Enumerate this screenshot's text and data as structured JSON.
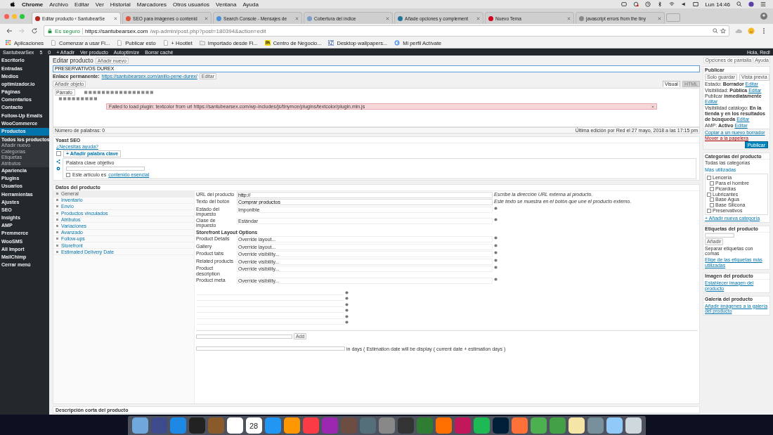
{
  "menubar": {
    "app": "Chrome",
    "items": [
      "Archivo",
      "Editar",
      "Ver",
      "Historial",
      "Marcadores",
      "Otros usuarios",
      "Ventana",
      "Ayuda"
    ],
    "clock": "Lun 14:46"
  },
  "tabs": [
    {
      "title": "Editar producto ‹ SantubearSe",
      "selected": true,
      "color": "#b3261e"
    },
    {
      "title": "SEO para imágenes o contenid",
      "selected": false,
      "color": "#e0533d"
    },
    {
      "title": "Search Console - Mensajes de",
      "selected": false,
      "color": "#4a90d9"
    },
    {
      "title": "Cobertura del índice",
      "selected": false,
      "color": "#7a9cc6"
    },
    {
      "title": "Añade opciones y complement",
      "selected": false,
      "color": "#21759b"
    },
    {
      "title": "Nuevo Tema",
      "selected": false,
      "color": "#d0021b"
    },
    {
      "title": "javascript errors from the tiny",
      "selected": false,
      "color": "#888888"
    }
  ],
  "address": {
    "secure_label": "Es seguro",
    "url_host": "https://santubearsex.com",
    "url_path": "/wp-admin/post.php?post=180394&action=edit"
  },
  "bookmarks": [
    {
      "label": "Aplicaciones",
      "kind": "apps"
    },
    {
      "label": "Comenzar a usar Fi...",
      "kind": "page"
    },
    {
      "label": "Publicar esto",
      "kind": "page"
    },
    {
      "label": "+ Hootlet",
      "kind": "page"
    },
    {
      "label": "Importado desde Fi...",
      "kind": "folder"
    },
    {
      "label": "Centro de Negocio...",
      "kind": "pa"
    },
    {
      "label": "Desktop wallpapers...",
      "kind": "iz"
    },
    {
      "label": "Mi perfil Actívate",
      "kind": "g"
    }
  ],
  "admin_bar": {
    "items": [
      "SantubearSex",
      "5",
      "0",
      "+ Añadir",
      "Ver producto",
      "Autoptimize",
      "Borrar caché"
    ],
    "greeting": "Hola, Red!"
  },
  "sidebar": {
    "items": [
      {
        "label": "Escritorio",
        "selected": false
      },
      {
        "label": "Entradas",
        "selected": false
      },
      {
        "label": "Medios",
        "selected": false
      },
      {
        "label": "optimizador.io",
        "selected": false
      },
      {
        "label": "Páginas",
        "selected": false
      },
      {
        "label": "Comentarios",
        "selected": false
      },
      {
        "label": "Contacto",
        "selected": false
      },
      {
        "label": "Follow-Up Emails",
        "selected": false
      },
      {
        "label": "WooCommerce",
        "selected": false
      },
      {
        "label": "Productos",
        "selected": true,
        "children": [
          {
            "label": "Todos los productos",
            "selected": true
          },
          {
            "label": "Añadir nuevo",
            "selected": false
          },
          {
            "label": "Categorías",
            "selected": false
          },
          {
            "label": "Etiquetas",
            "selected": false
          },
          {
            "label": "Atributos",
            "selected": false
          }
        ]
      },
      {
        "label": "Apariencia",
        "selected": false
      },
      {
        "label": "Plugins",
        "selected": false
      },
      {
        "label": "Usuarios",
        "selected": false
      },
      {
        "label": "Herramientas",
        "selected": false
      },
      {
        "label": "Ajustes",
        "selected": false
      },
      {
        "label": "SEO",
        "selected": false
      },
      {
        "label": "Insights",
        "selected": false
      },
      {
        "label": "AMP",
        "selected": false
      },
      {
        "label": "Premmerce",
        "selected": false
      },
      {
        "label": "WooSMS",
        "selected": false
      },
      {
        "label": "All Import",
        "selected": false
      },
      {
        "label": "MailChimp",
        "selected": false
      },
      {
        "label": "Cerrar menú",
        "selected": false
      }
    ]
  },
  "screen_options": "Opciones de pantalla",
  "help": "Ayuda",
  "page": {
    "heading": "Editar producto",
    "add_new": "Añadir nuevo",
    "title_value": "PRESERVATIVOS DUREX",
    "permalink_label": "Enlace permanente:",
    "permalink_url": "https://santubearsex.com/anillo-pene-durex/",
    "permalink_edit": "Editar"
  },
  "editor": {
    "add_media": "Añadir objeto",
    "tabs": [
      {
        "label": "Visual",
        "selected": true
      },
      {
        "label": "HTML",
        "selected": false
      }
    ],
    "format": "Párrafo",
    "notice": "Failed to load plugin: textcolor from url https://santubearsex.com/wp-includes/js/tinymce/plugins/textcolor/plugin.min.js",
    "word_count": "Número de palabras: 0",
    "last_edit": "Última edición por Red el 27 mayo, 2018 a las 17:15 pm"
  },
  "yoast": {
    "title": "Yoast SEO",
    "help": "¿Necesitas ayuda?",
    "add_keyword": "+ Añadir palabra clave",
    "keyword_label": "Palabra clave objetivo",
    "cornerstone_text": "Este artículo es",
    "cornerstone_link": "contenido esencial",
    "cornerstone_checked": false
  },
  "product_data": {
    "title": "Datos del producto",
    "tabs": [
      {
        "label": "General",
        "selected": true
      },
      {
        "label": "Inventario",
        "selected": false
      },
      {
        "label": "Envío",
        "selected": false
      },
      {
        "label": "Productos vinculados",
        "selected": false
      },
      {
        "label": "Atributos",
        "selected": false
      },
      {
        "label": "Variaciones",
        "selected": false
      },
      {
        "label": "Avanzado",
        "selected": false
      },
      {
        "label": "Follow-ups",
        "selected": false
      },
      {
        "label": "Storefront",
        "selected": false
      },
      {
        "label": "Estimated Delivery Date",
        "selected": false
      }
    ],
    "fields": [
      {
        "kind": "text",
        "label": "URL del producto",
        "value": "http://",
        "hint": "Escribe la dirección URL externa al producto."
      },
      {
        "kind": "text",
        "label": "Texto del botón",
        "value": "Comprar productos",
        "hint": "Este texto se muestra en el botón que une el producto externo."
      },
      {
        "kind": "select",
        "label": "Estado del impuesto",
        "value": "Imponible"
      },
      {
        "kind": "select",
        "label": "Clase de impuesto",
        "value": "Estándar"
      },
      {
        "kind": "heading",
        "label": "Storefront Layout Options"
      },
      {
        "kind": "select",
        "label": "Product Details",
        "value": "Override layout..."
      },
      {
        "kind": "select",
        "label": "Gallery",
        "value": "Override layout..."
      },
      {
        "kind": "select",
        "label": "Product tabs",
        "value": "Override visibility..."
      },
      {
        "kind": "select",
        "label": "Related products",
        "value": "Override visibility..."
      },
      {
        "kind": "select",
        "label": "Product description",
        "value": "Override visibility..."
      },
      {
        "kind": "select",
        "label": "Product meta",
        "value": "Override visibility..."
      }
    ],
    "add_button": "Add",
    "days_hint": "in days ( Estimation date will be display ( current date + estimation days )"
  },
  "short_description": "Descripción corta del producto",
  "publish": {
    "title": "Publicar",
    "save": "Solo guardar",
    "preview": "Vista previa",
    "rows": [
      {
        "label": "Estado:",
        "value": "Borrador",
        "edit": "Editar"
      },
      {
        "label": "Visibilidad:",
        "value": "Pública",
        "edit": "Editar"
      },
      {
        "label": "Publicar",
        "value": "inmediatamente",
        "edit": "Editar"
      },
      {
        "label": "Visibilidad catálogo:",
        "value": "En la tienda y en los resultados de búsqueda",
        "edit": "Editar"
      },
      {
        "label": "AMP:",
        "value": "Activo",
        "edit": "Editar"
      }
    ],
    "copy": "Copiar a un nuevo borrador",
    "trash": "Mover a la papelera",
    "button": "Publicar"
  },
  "categories": {
    "title": "Categorías del producto",
    "tabs": [
      {
        "label": "Todas las categorías",
        "selected": true
      },
      {
        "label": "Más utilizadas",
        "selected": false
      }
    ],
    "items": [
      {
        "label": "Lencería",
        "checked": false,
        "children": [
          {
            "label": "Para el hombre",
            "checked": false
          },
          {
            "label": "Picardías",
            "checked": false
          }
        ]
      },
      {
        "label": "Lubricantes",
        "checked": false,
        "children": [
          {
            "label": "Base Agua",
            "checked": false
          },
          {
            "label": "Base Silicona",
            "checked": false
          }
        ]
      },
      {
        "label": "Preservativos",
        "checked": false
      }
    ],
    "add": "+ Añadir nueva categoría"
  },
  "tags": {
    "title": "Etiquetas del producto",
    "add": "Añadir",
    "hint": "Separar etiquetas con comas",
    "choose": "Elige de las etiquetas más utilizadas"
  },
  "image": {
    "title": "Imagen del producto",
    "link": "Establecer imagen del producto"
  },
  "gallery": {
    "title": "Galería del producto",
    "link": "Añadir imágenes a la galería del producto"
  },
  "dock": {
    "calendar_day": "28"
  }
}
